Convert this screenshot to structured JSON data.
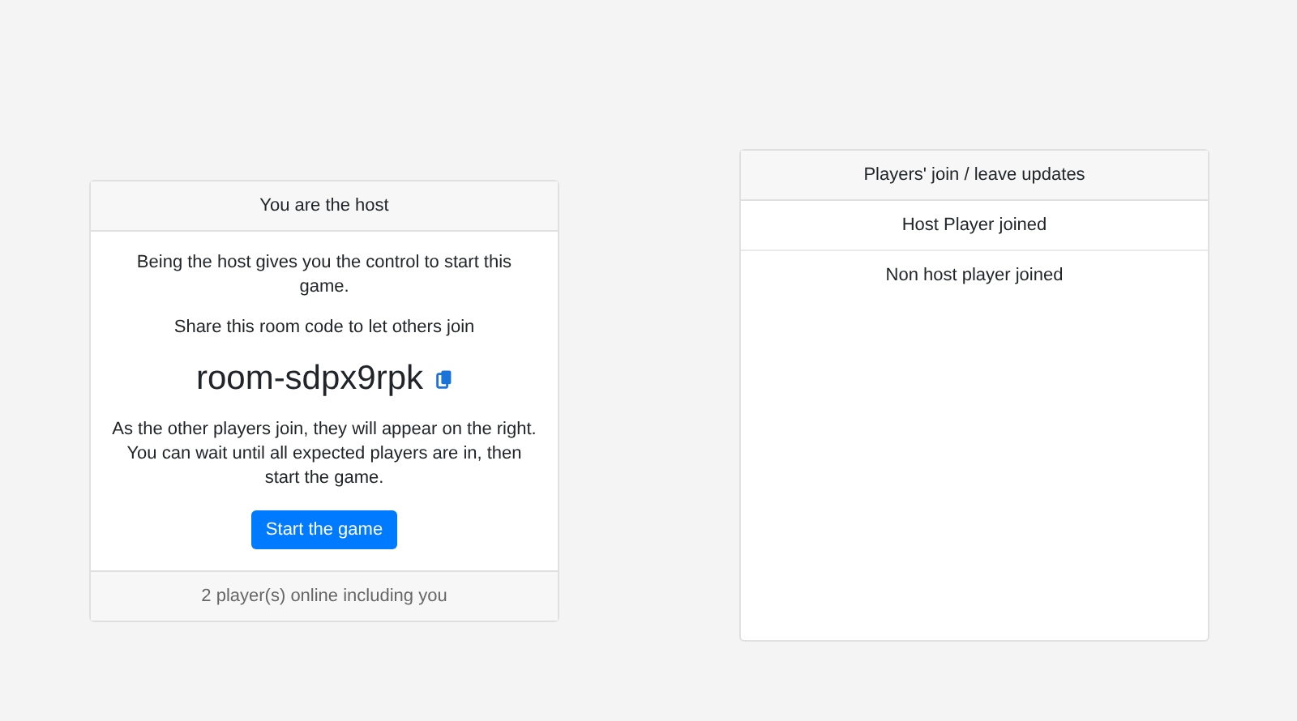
{
  "host_card": {
    "title": "You are the host",
    "intro": "Being the host gives you the control to start this game.",
    "share_hint": "Share this room code to let others join",
    "room_code": "room-sdpx9rpk",
    "note": "As the other players join, they will appear on the right. You can wait until all expected players are in, then start the game.",
    "button": "Start the game",
    "footer": "2 player(s) online including you"
  },
  "updates_card": {
    "title": "Players' join / leave updates",
    "items": [
      "Host Player joined",
      "Non host player joined"
    ]
  }
}
